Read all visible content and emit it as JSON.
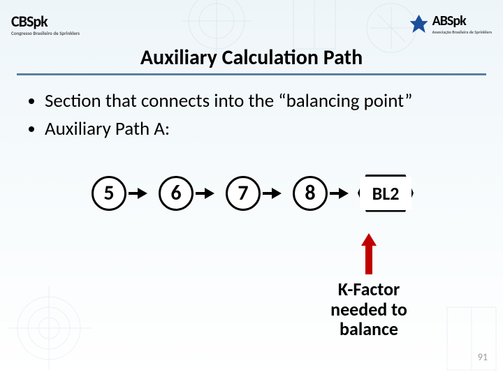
{
  "logos": {
    "left": {
      "main": "CBSpk",
      "sub": "Congresso Brasileiro de Sprinklers"
    },
    "right": {
      "main": "ABSpk",
      "sub": "Associação Brasileira de Sprinklers"
    }
  },
  "title": "Auxiliary Calculation Path",
  "bullets": [
    "Section that connects into the “balancing point”",
    "Auxiliary Path A:"
  ],
  "flow": {
    "nodes": [
      "5",
      "6",
      "7",
      "8"
    ],
    "terminal": "BL2"
  },
  "annotation": {
    "line1": "K-Factor",
    "line2": "needed to",
    "line3": "balance"
  },
  "page_number": "91"
}
